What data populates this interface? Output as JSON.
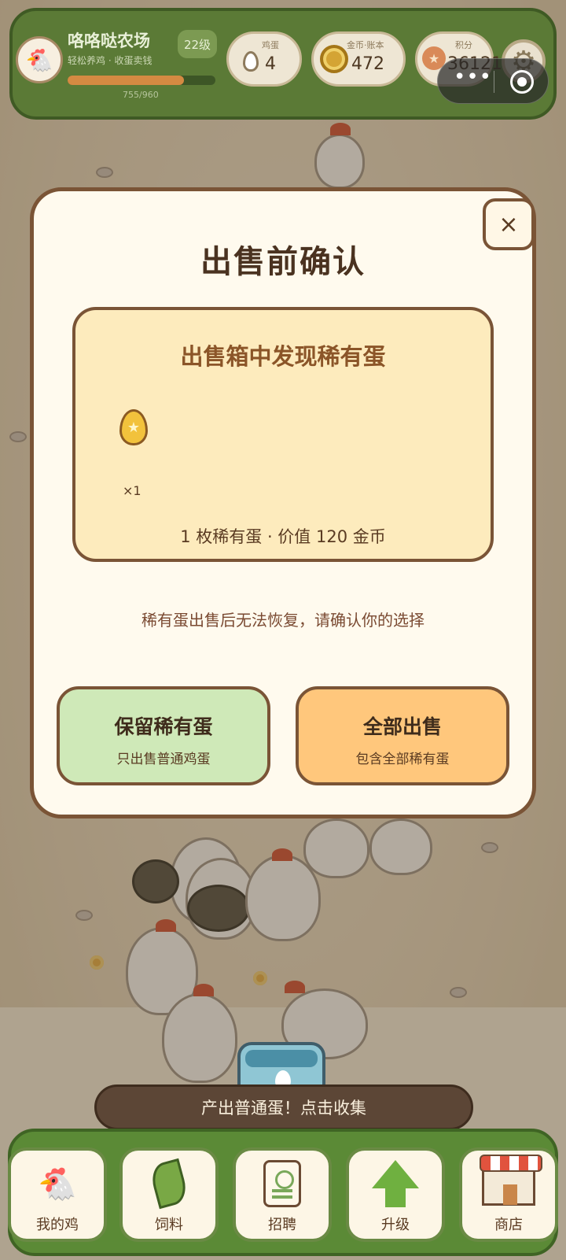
{
  "header": {
    "farm_name": "咯咯哒农场",
    "farm_subtitle": "轻松养鸡 · 收蛋卖钱",
    "level": "22级",
    "xp_text": "755/960",
    "xp_progress": 0.786,
    "stats": {
      "eggs": {
        "label": "鸡蛋",
        "value": "4"
      },
      "coins": {
        "label": "金币·账本",
        "value": "472"
      },
      "points": {
        "label": "积分",
        "value": "36121"
      }
    },
    "settings_icon": "gear-icon",
    "capsule_icons": [
      "more-dots-icon",
      "close-target-icon"
    ]
  },
  "modal": {
    "title": "出售前确认",
    "close_label": "×",
    "rare_panel": {
      "title": "出售箱中发现稀有蛋",
      "egg_count": "×1",
      "summary": "1 枚稀有蛋 · 价值 120 金币"
    },
    "warning": "稀有蛋出售后无法恢复，请确认你的选择",
    "keep_button": {
      "label": "保留稀有蛋",
      "sub": "只出售普通鸡蛋"
    },
    "sell_button": {
      "label": "全部出售",
      "sub": "包含全部稀有蛋"
    }
  },
  "toast": "产出普通蛋！点击收集",
  "nav": [
    {
      "label": "我的鸡",
      "icon": "chicken-icon"
    },
    {
      "label": "饲料",
      "icon": "leaf-icon"
    },
    {
      "label": "招聘",
      "icon": "badge-card-icon"
    },
    {
      "label": "升级",
      "icon": "arrow-up-icon"
    },
    {
      "label": "商店",
      "icon": "shop-icon"
    }
  ],
  "colors": {
    "header_green": "#5b7a36",
    "modal_bg": "#fffaee",
    "panel_bg": "#fdebbd",
    "keep_green": "#cfe9b8",
    "sell_orange": "#ffc77c",
    "border_brown": "#7a5436"
  }
}
